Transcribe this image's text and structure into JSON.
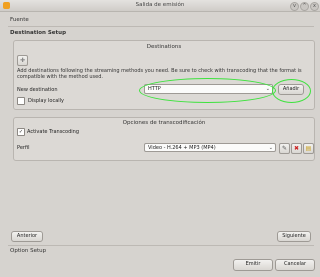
{
  "window": {
    "title": "Salida de emisión",
    "controls": [
      "v",
      "^",
      "x"
    ]
  },
  "breadcrumb_top": "Fuente",
  "destination_setup": {
    "header": "Destination Setup",
    "group_title": "Destinations",
    "info_text": "Add destinations following the streaming methods you need. Be sure to check with transcoding that the format is compatible with the method used.",
    "new_destination_label": "New destination",
    "new_destination_value": "HTTP",
    "add_button": "Añadir",
    "display_locally_label": "Display locally",
    "display_locally_checked": false
  },
  "transcoding": {
    "group_title": "Opciones de transcodificación",
    "activate_label": "Activate Transcoding",
    "activate_checked": true,
    "activate_mark": "✓",
    "profile_label": "Perfil",
    "profile_value": "Video - H.264 + MP3 (MP4)"
  },
  "navigation": {
    "back_button": "Anterior",
    "next_button": "Siguiente"
  },
  "breadcrumb_bottom": "Option Setup",
  "footer": {
    "stream_button": "Emitir",
    "cancel_button": "Cancelar"
  },
  "colors": {
    "highlight_circle": "#3ee23e",
    "delete_icon": "#cc2222"
  }
}
